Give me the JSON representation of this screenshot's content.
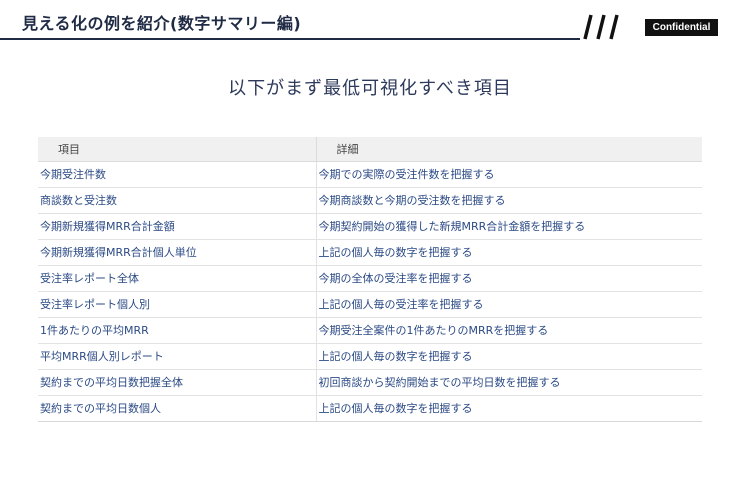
{
  "header": {
    "title": "見える化の例を紹介(数字サマリー編)",
    "confidential": "Confidential"
  },
  "slide": {
    "heading": "以下がまず最低可視化すべき項目"
  },
  "table": {
    "headers": [
      "項目",
      "詳細"
    ],
    "rows": [
      [
        "今期受注件数",
        "今期での実際の受注件数を把握する"
      ],
      [
        "商談数と受注数",
        "今期商談数と今期の受注数を把握する"
      ],
      [
        "今期新規獲得MRR合計金額",
        "今期契約開始の獲得した新規MRR合計金額を把握する"
      ],
      [
        "今期新規獲得MRR合計個人単位",
        "上記の個人毎の数字を把握する"
      ],
      [
        "受注率レポート全体",
        "今期の全体の受注率を把握する"
      ],
      [
        "受注率レポート個人別",
        "上記の個人毎の受注率を把握する"
      ],
      [
        "1件あたりの平均MRR",
        "今期受注全案件の1件あたりのMRRを把握する"
      ],
      [
        "平均MRR個人別レポート",
        "上記の個人毎の数字を把握する"
      ],
      [
        "契約までの平均日数把握全体",
        "初回商談から契約開始までの平均日数を把握する"
      ],
      [
        "契約までの平均日数個人",
        "上記の個人毎の数字を把握する"
      ]
    ]
  }
}
